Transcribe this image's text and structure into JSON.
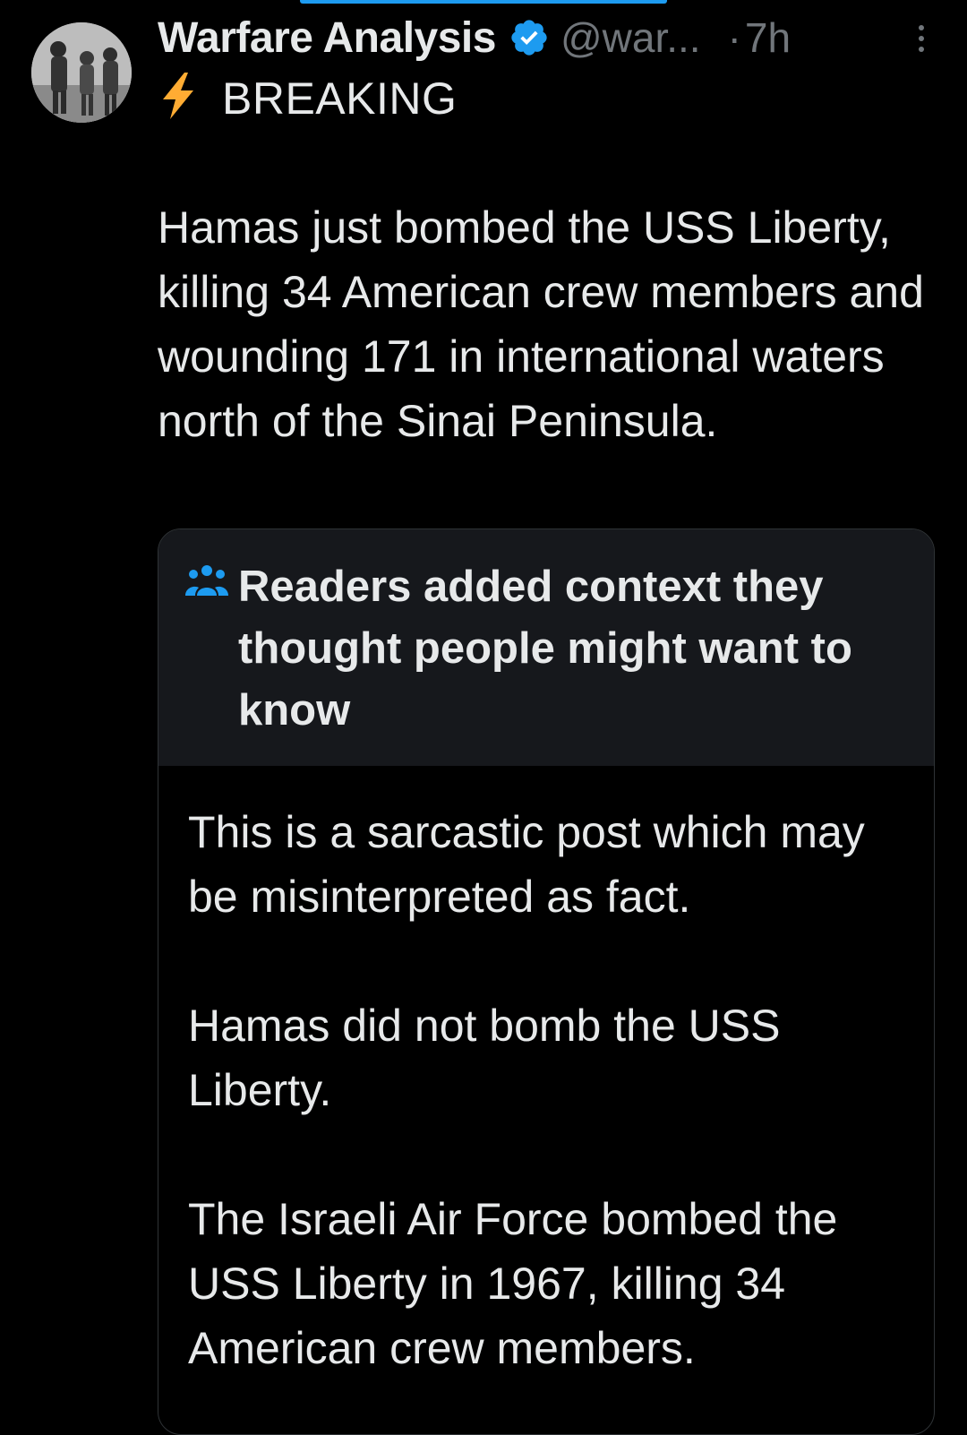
{
  "post": {
    "display_name": "Warfare Analysis",
    "handle": "@war...",
    "separator": "·",
    "time": "7h",
    "icon_names": {
      "avatar": "avatar",
      "verified": "verified-badge-icon",
      "more": "more-options-icon",
      "bolt": "lightning-bolt-icon"
    },
    "breaking_label": "BREAKING",
    "body": "Hamas just bombed the USS Liberty, killing 34 American crew members and wounding 171 in international waters north of the Sinai Peninsula."
  },
  "community_note": {
    "icon_name": "people-icon",
    "title": "Readers added context they thought people might want to know",
    "paragraphs": [
      "This is a sarcastic post which may be misinterpreted as fact.",
      "Hamas did not bomb the USS Liberty.",
      "The Israeli Air Force bombed the USS Liberty in 1967, killing 34 American crew members."
    ]
  },
  "colors": {
    "background": "#000000",
    "text": "#e7e9ea",
    "muted": "#71767b",
    "accent_blue": "#1d9bf0",
    "bolt_yellow": "#ffac33",
    "note_header_bg": "#16181c",
    "border": "#2f3336"
  }
}
